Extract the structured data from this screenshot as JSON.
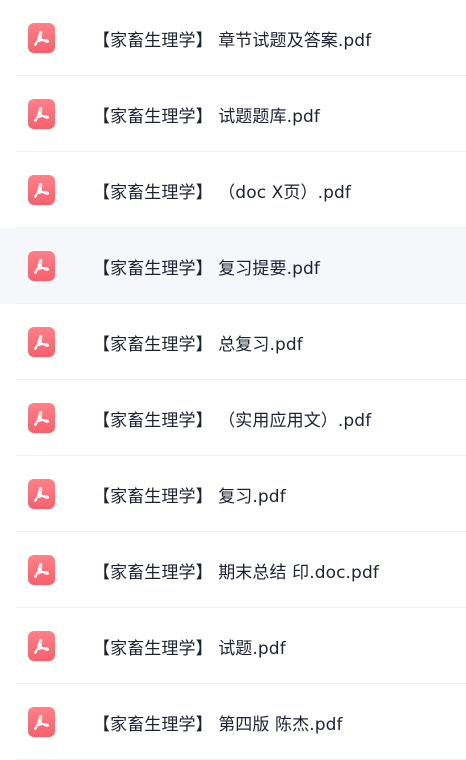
{
  "colors": {
    "icon_gradient_top": "#ff8088",
    "icon_gradient_bottom": "#f7606d",
    "highlight_row": "#f5f7fb",
    "text": "#1d2233"
  },
  "files": [
    {
      "name": "【家畜生理学】 章节试题及答案.pdf",
      "icon": "pdf-icon"
    },
    {
      "name": "【家畜生理学】 试题题库.pdf",
      "icon": "pdf-icon"
    },
    {
      "name": "【家畜生理学】 （doc X页）.pdf",
      "icon": "pdf-icon"
    },
    {
      "name": "【家畜生理学】 复习提要.pdf",
      "icon": "pdf-icon",
      "highlighted": true
    },
    {
      "name": "【家畜生理学】 总复习.pdf",
      "icon": "pdf-icon"
    },
    {
      "name": "【家畜生理学】 （实用应用文）.pdf",
      "icon": "pdf-icon"
    },
    {
      "name": "【家畜生理学】 复习.pdf",
      "icon": "pdf-icon"
    },
    {
      "name": "【家畜生理学】 期末总结 印.doc.pdf",
      "icon": "pdf-icon"
    },
    {
      "name": "【家畜生理学】 试题.pdf",
      "icon": "pdf-icon"
    },
    {
      "name": "【家畜生理学】 第四版 陈杰.pdf",
      "icon": "pdf-icon"
    }
  ]
}
